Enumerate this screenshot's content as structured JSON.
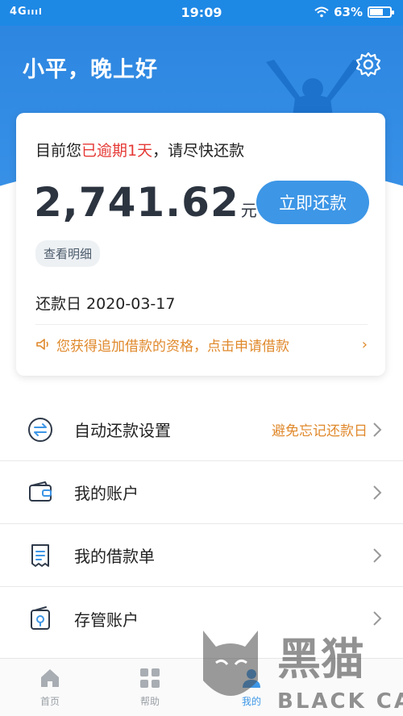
{
  "status_bar": {
    "network": "4G",
    "time": "19:09",
    "battery": "63%",
    "battery_level": 0.63
  },
  "header": {
    "greeting": "小平，晚上好"
  },
  "bill": {
    "notice_prefix": "目前您",
    "notice_highlight": "已逾期1天",
    "notice_suffix": "，请尽快还款",
    "amount": "2,741.62",
    "unit": "元",
    "pay_button": "立即还款",
    "detail_button": "查看明细",
    "due_label": "还款日 2020-03-17",
    "promo_text": "您获得追加借款的资格，点击申请借款"
  },
  "menu": {
    "items": [
      {
        "label": "自动还款设置",
        "hint": "避免忘记还款日",
        "icon": "auto-repay-icon"
      },
      {
        "label": "我的账户",
        "hint": "",
        "icon": "wallet-icon"
      },
      {
        "label": "我的借款单",
        "hint": "",
        "icon": "document-icon"
      },
      {
        "label": "存管账户",
        "hint": "",
        "icon": "lock-account-icon"
      }
    ]
  },
  "tabbar": {
    "tabs": [
      {
        "label": "首页",
        "icon": "home-icon"
      },
      {
        "label": "帮助",
        "icon": "grid-icon"
      },
      {
        "label": "我的",
        "icon": "user-icon",
        "active": true
      }
    ]
  },
  "watermark": {
    "text_cn": "黑猫",
    "text_en": "BLACK CAT"
  },
  "colors": {
    "primary": "#3d96e6",
    "header_bg": "#2d86e0",
    "overdue_red": "#e53935",
    "promo_orange": "#e0892c"
  }
}
